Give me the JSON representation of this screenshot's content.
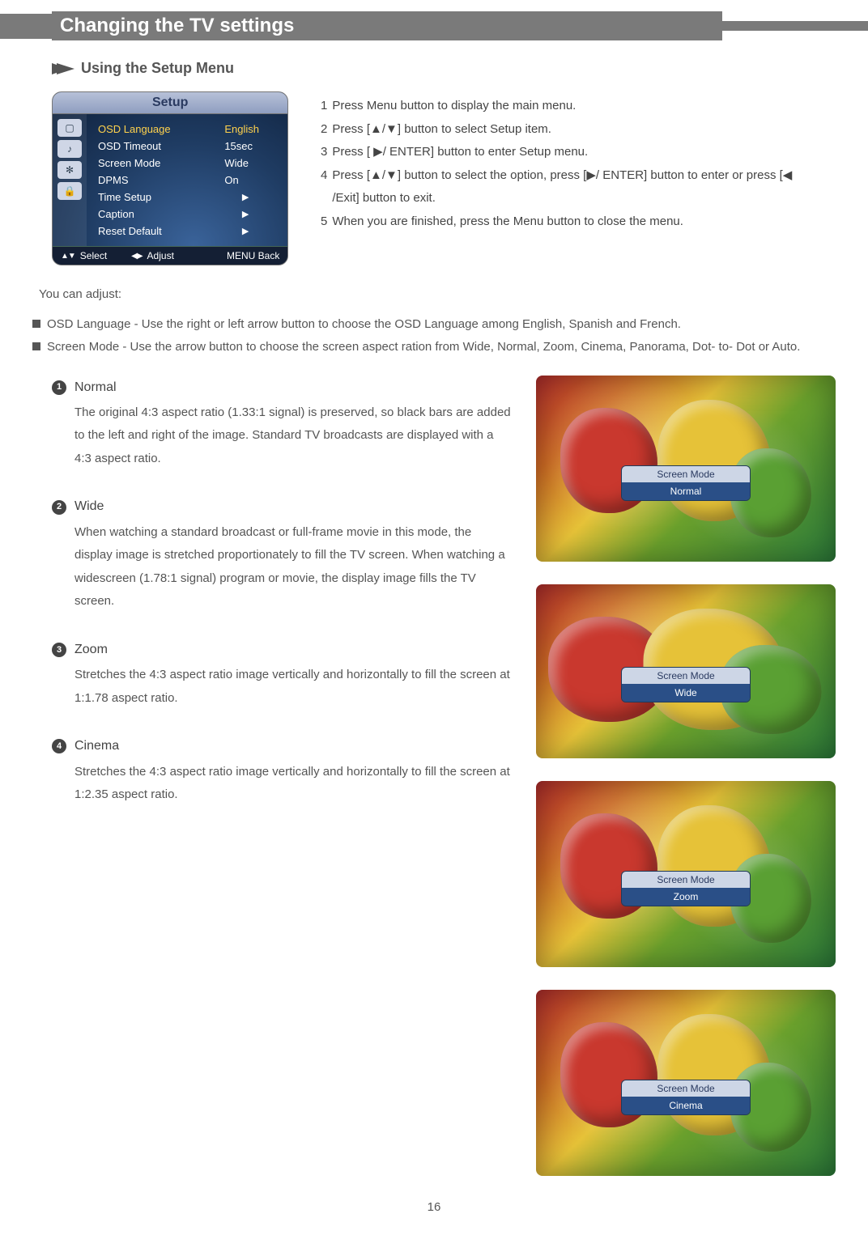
{
  "header": {
    "title": "Changing the TV settings"
  },
  "section_title": "Using the Setup Menu",
  "osd": {
    "title": "Setup",
    "items": [
      {
        "label": "OSD  Language",
        "value": "English"
      },
      {
        "label": "OSD Timeout",
        "value": "15sec"
      },
      {
        "label": "Screen  Mode",
        "value": "Wide"
      },
      {
        "label": "DPMS",
        "value": "On"
      },
      {
        "label": "Time Setup",
        "value": "▶"
      },
      {
        "label": "Caption",
        "value": "▶"
      },
      {
        "label": "Reset Default",
        "value": "▶"
      }
    ],
    "footer": {
      "select": "Select",
      "adjust": "Adjust",
      "back": "MENU  Back"
    }
  },
  "instructions": [
    {
      "n": "1",
      "t": "Press Menu button to display the main menu."
    },
    {
      "n": "2",
      "t": "Press [▲/▼] button to select Setup item."
    },
    {
      "n": "3",
      "t": "Press [ ▶/ ENTER] button to enter Setup menu."
    },
    {
      "n": "4",
      "t": "Press [▲/▼] button to select the option, press [▶/ ENTER] button to enter or press [◀ /Exit] button to exit."
    },
    {
      "n": "5",
      "t": "When you are finished, press the Menu button to close the menu."
    }
  ],
  "adjust_intro": "You can adjust:",
  "adjust_items": [
    "OSD Language - Use the right or left arrow button to choose the OSD Language among English, Spanish and French.",
    "Screen Mode -  Use the arrow button to choose the screen aspect ration from Wide, Normal, Zoom, Cinema, Panorama, Dot- to- Dot or Auto."
  ],
  "modes": [
    {
      "n": "1",
      "title": "Normal",
      "body": "The original 4:3 aspect ratio (1.33:1 signal) is preserved, so black bars are added to the left and right of the image. Standard TV broadcasts are displayed with a 4:3 aspect ratio."
    },
    {
      "n": "2",
      "title": "Wide",
      "body": "When watching a standard broadcast or full-frame movie in this mode, the display image is stretched proportionately to fill the TV screen. When watching a widescreen (1.78:1 signal) program or movie, the display image fills the TV screen."
    },
    {
      "n": "3",
      "title": "Zoom",
      "body": "Stretches the 4:3 aspect ratio image vertically and horizontally to fill the screen at 1:1.78 aspect ratio."
    },
    {
      "n": "4",
      "title": "Cinema",
      "body": "Stretches the 4:3 aspect ratio image vertically and horizontally to fill the screen at 1:2.35 aspect ratio."
    }
  ],
  "shots": {
    "popup_label": "Screen Mode",
    "values": [
      "Normal",
      "Wide",
      "Zoom",
      "Cinema"
    ]
  },
  "page_num": "16"
}
